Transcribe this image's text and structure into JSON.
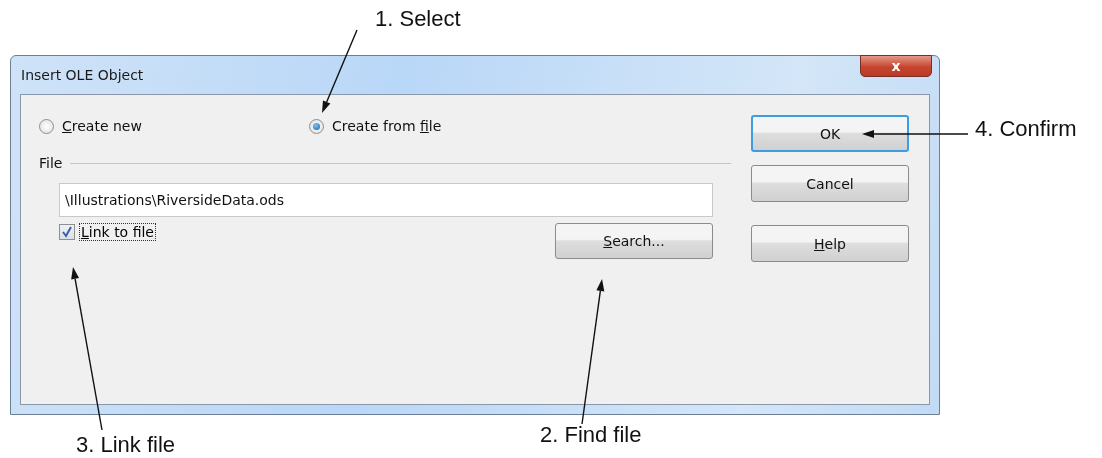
{
  "window": {
    "title": "Insert OLE Object",
    "close_label": "x"
  },
  "options": [
    {
      "key": "C",
      "post": "reate new",
      "selected": false
    },
    {
      "pre": "Create from ",
      "key": "f",
      "post": "ile",
      "selected": true
    }
  ],
  "file_group": {
    "title": "File",
    "path": "\\Illustrations\\RiversideData.ods",
    "link": {
      "key": "L",
      "post": "ink to file",
      "checked": true
    },
    "search": {
      "key": "S",
      "post": "earch..."
    }
  },
  "buttons": [
    {
      "pre": "OK",
      "default": true
    },
    {
      "pre": "Cancel",
      "default": false
    },
    {
      "key": "H",
      "post": "elp",
      "default": false
    }
  ],
  "callouts": [
    {
      "text": "1. Select"
    },
    {
      "text": "4. Confirm"
    },
    {
      "text": "3. Link file"
    },
    {
      "text": "2. Find file"
    }
  ]
}
